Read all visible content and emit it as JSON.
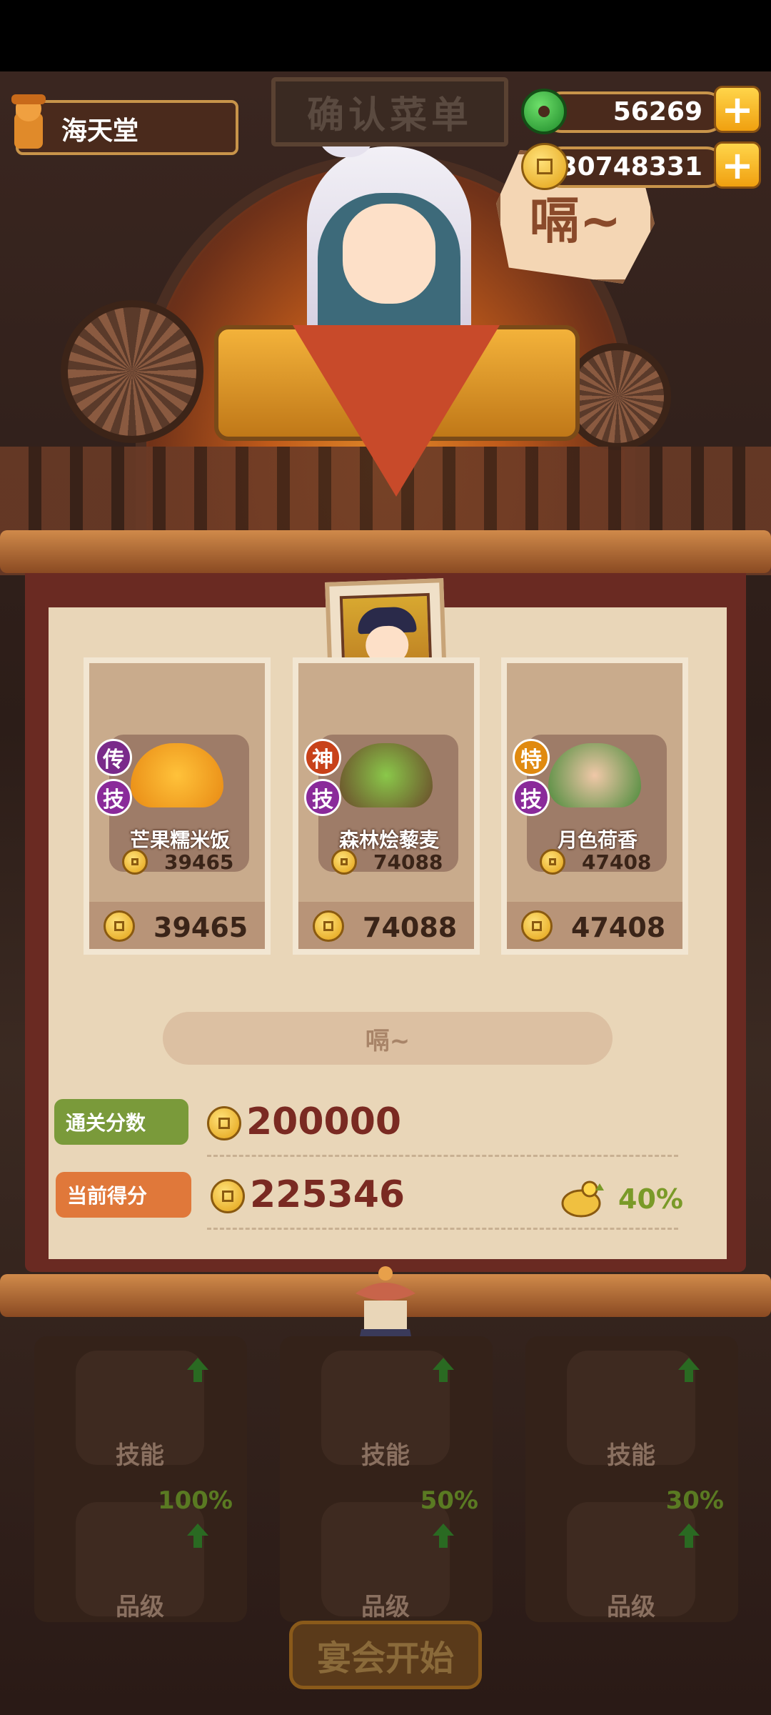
{
  "top_bar": {
    "restaurant_name": "海天堂",
    "title": "确认菜单",
    "jade_amount": "56269",
    "coin_amount": "30748331",
    "plus_symbol": "+"
  },
  "scene": {
    "speech_bubble": "嗝~"
  },
  "dishes": [
    {
      "badge1": "传",
      "badge2": "技",
      "name": "芒果糯米饭",
      "price_small": "39465",
      "price": "39465",
      "badge1_color": "#7a2a8a"
    },
    {
      "badge1": "神",
      "badge2": "技",
      "name": "森林烩藜麦",
      "price_small": "74088",
      "price": "74088",
      "badge1_color": "#c8421a"
    },
    {
      "badge1": "特",
      "badge2": "技",
      "name": "月色荷香",
      "price_small": "47408",
      "price": "47408",
      "badge1_color": "#e08a10"
    }
  ],
  "sniff_text": "嗝~",
  "scores": {
    "pass_label": "通关分数",
    "pass_value": "200000",
    "current_label": "当前得分",
    "current_value": "225346",
    "bonus_percent": "40%"
  },
  "bottom": {
    "columns": [
      {
        "skill_label": "技能",
        "grade_label": "品级",
        "grade_percent": "100%"
      },
      {
        "skill_label": "技能",
        "grade_label": "品级",
        "grade_percent": "50%"
      },
      {
        "skill_label": "技能",
        "grade_label": "品级",
        "grade_percent": "30%"
      }
    ],
    "start_button": "宴会开始"
  },
  "colors": {
    "pass_label_bg": "#7a9a3a",
    "current_label_bg": "#e0783a",
    "score_value": "#7a2a22",
    "percent_green": "#7a9a28"
  }
}
